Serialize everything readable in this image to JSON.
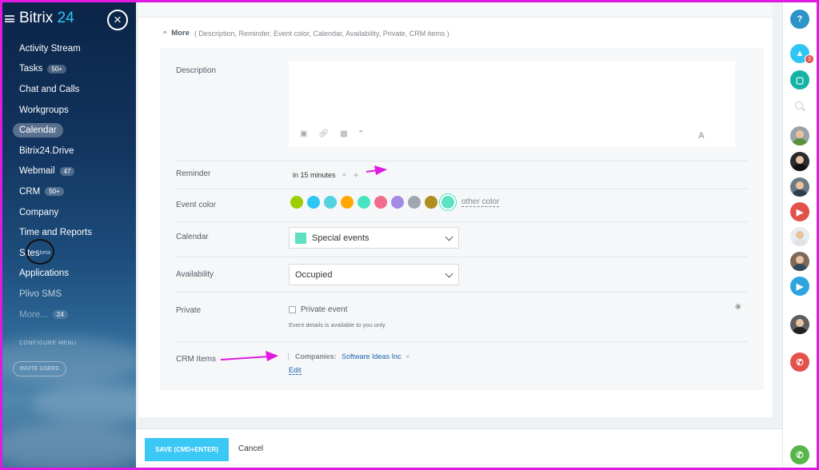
{
  "sidebar": {
    "brand_name": "Bitrix",
    "brand_num": "24",
    "close_glyph": "×",
    "items": [
      {
        "label": "Activity Stream",
        "badge": ""
      },
      {
        "label": "Tasks",
        "badge": "50+"
      },
      {
        "label": "Chat and Calls",
        "badge": ""
      },
      {
        "label": "Workgroups",
        "badge": ""
      },
      {
        "label": "Calendar",
        "badge": ""
      },
      {
        "label": "Bitrix24.Drive",
        "badge": ""
      },
      {
        "label": "Webmail",
        "badge": "47"
      },
      {
        "label": "CRM",
        "badge": "50+"
      },
      {
        "label": "Company",
        "badge": ""
      },
      {
        "label": "Time and Reports",
        "badge": ""
      },
      {
        "label": "Sites",
        "badge": "beta"
      },
      {
        "label": "Applications",
        "badge": ""
      },
      {
        "label": "Plivo SMS",
        "badge": ""
      },
      {
        "label": "More...",
        "badge": "24"
      }
    ],
    "configure_menu": "CONFIGURE MENU",
    "invite_users": "INVITE USERS"
  },
  "form": {
    "more_label": "More",
    "more_sections": "( Description,  Reminder,  Event color,  Calendar,  Availability,  Private,  CRM items )",
    "description_label": "Description",
    "reminder_label": "Reminder",
    "reminder_value": "in 15 minutes",
    "event_color_label": "Event color",
    "colors": [
      "#9dcf00",
      "#2fc6f6",
      "#56d1e0",
      "#ffa900",
      "#47e4c2",
      "#f26b8b",
      "#a38be5",
      "#a0a7ae",
      "#b18c1e",
      "#5fe0c0"
    ],
    "other_color": "other color",
    "calendar_label": "Calendar",
    "calendar_value": "Special events",
    "availability_label": "Availability",
    "availability_value": "Occupied",
    "private_label": "Private",
    "private_checkbox": "Private event",
    "private_hint": "Event details is available to you only.",
    "crm_label": "CRM Items",
    "crm_companies_label": "Companies:",
    "crm_companies_value": "Software Ideas Inc",
    "crm_edit": "Edit"
  },
  "footer": {
    "save_label": "SAVE (CMD+ENTER)",
    "cancel_label": "Cancel"
  },
  "rightbar": {
    "help": "?",
    "notif_count": "3"
  },
  "accent": {
    "annotation": "#e01ae0",
    "brand_blue": "#2fc6f6"
  }
}
